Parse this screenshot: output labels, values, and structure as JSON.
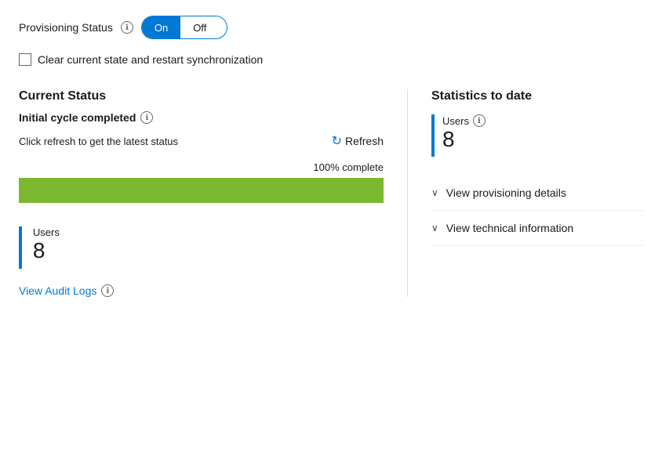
{
  "provisioning": {
    "label": "Provisioning Status",
    "info_icon": "ℹ",
    "toggle_on": "On",
    "toggle_off": "Off"
  },
  "checkbox": {
    "label": "Clear current state and restart synchronization"
  },
  "left": {
    "current_status_title": "Current Status",
    "initial_cycle_text": "Initial cycle completed",
    "info_icon": "ℹ",
    "refresh_hint": "Click refresh to get the latest status",
    "refresh_label": "Refresh",
    "progress_label": "100% complete",
    "users_label": "Users",
    "users_count": "8",
    "audit_logs_label": "View Audit Logs",
    "audit_info_icon": "ℹ"
  },
  "right": {
    "stats_title": "Statistics to date",
    "users_label": "Users",
    "users_info_icon": "ℹ",
    "users_count": "8",
    "view_provisioning_label": "View provisioning details",
    "view_technical_label": "View technical information",
    "chevron": "∨"
  }
}
